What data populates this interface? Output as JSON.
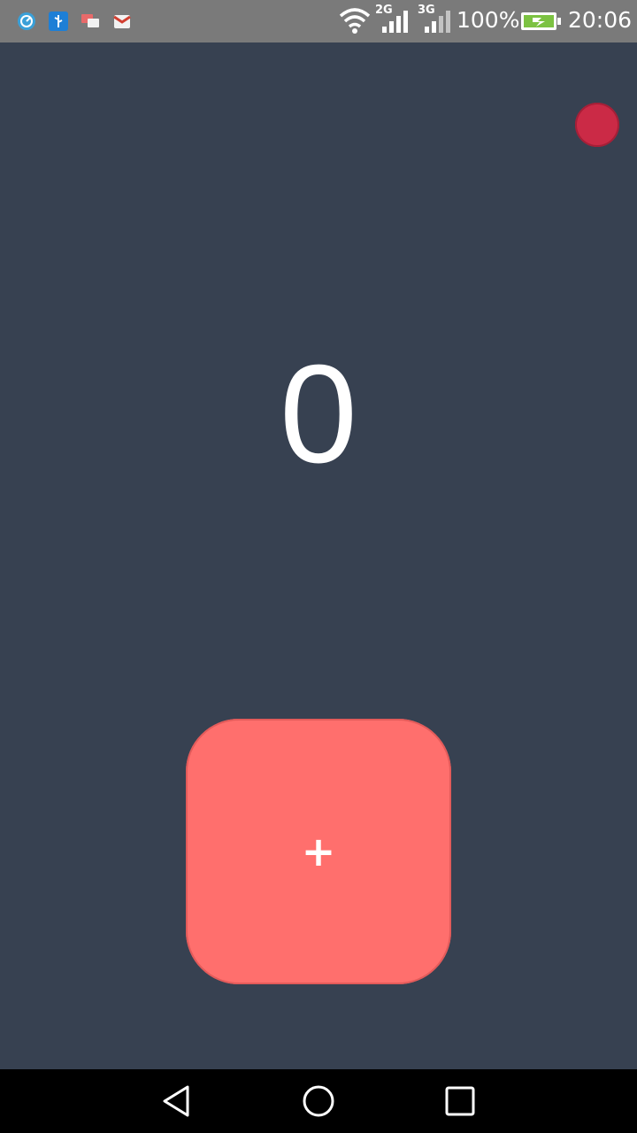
{
  "status_bar": {
    "icons": [
      "speed-icon",
      "usb-icon",
      "cast-icon",
      "gmail-icon",
      "wifi-icon",
      "signal-2g-icon",
      "signal-3g-icon",
      "battery-charging-icon"
    ],
    "network_2g_label": "2G",
    "network_3g_label": "3G",
    "battery_percent": "100%",
    "time": "20:06"
  },
  "app": {
    "counter_value": "0",
    "add_button_label": "+",
    "colors": {
      "background": "#374151",
      "record_dot": "#cb2a46",
      "add_button": "#ff6f6d"
    }
  },
  "nav_bar": {
    "buttons": [
      "back-icon",
      "home-icon",
      "recents-icon"
    ]
  }
}
